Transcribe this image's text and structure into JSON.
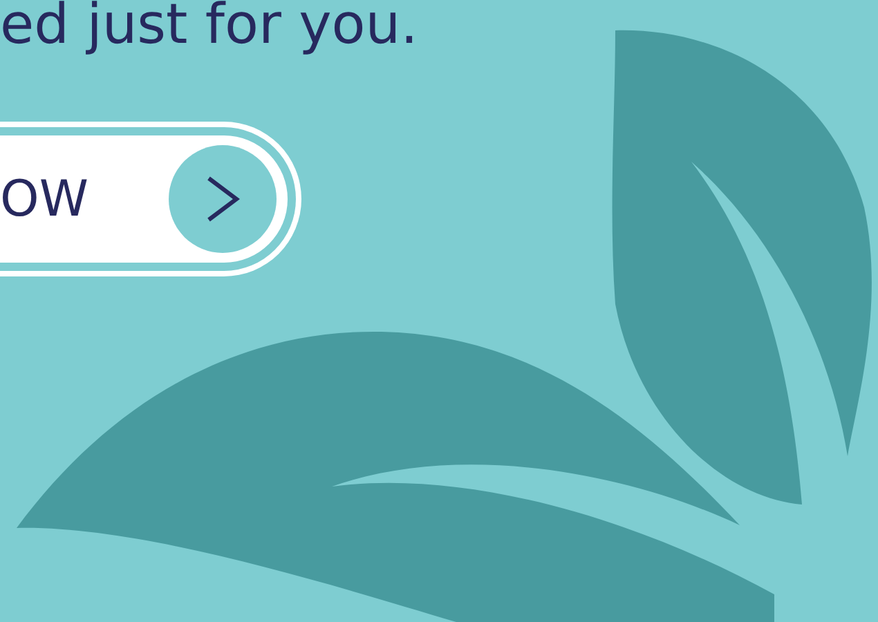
{
  "heading": "ed just for you.",
  "button": {
    "label": "OW"
  }
}
